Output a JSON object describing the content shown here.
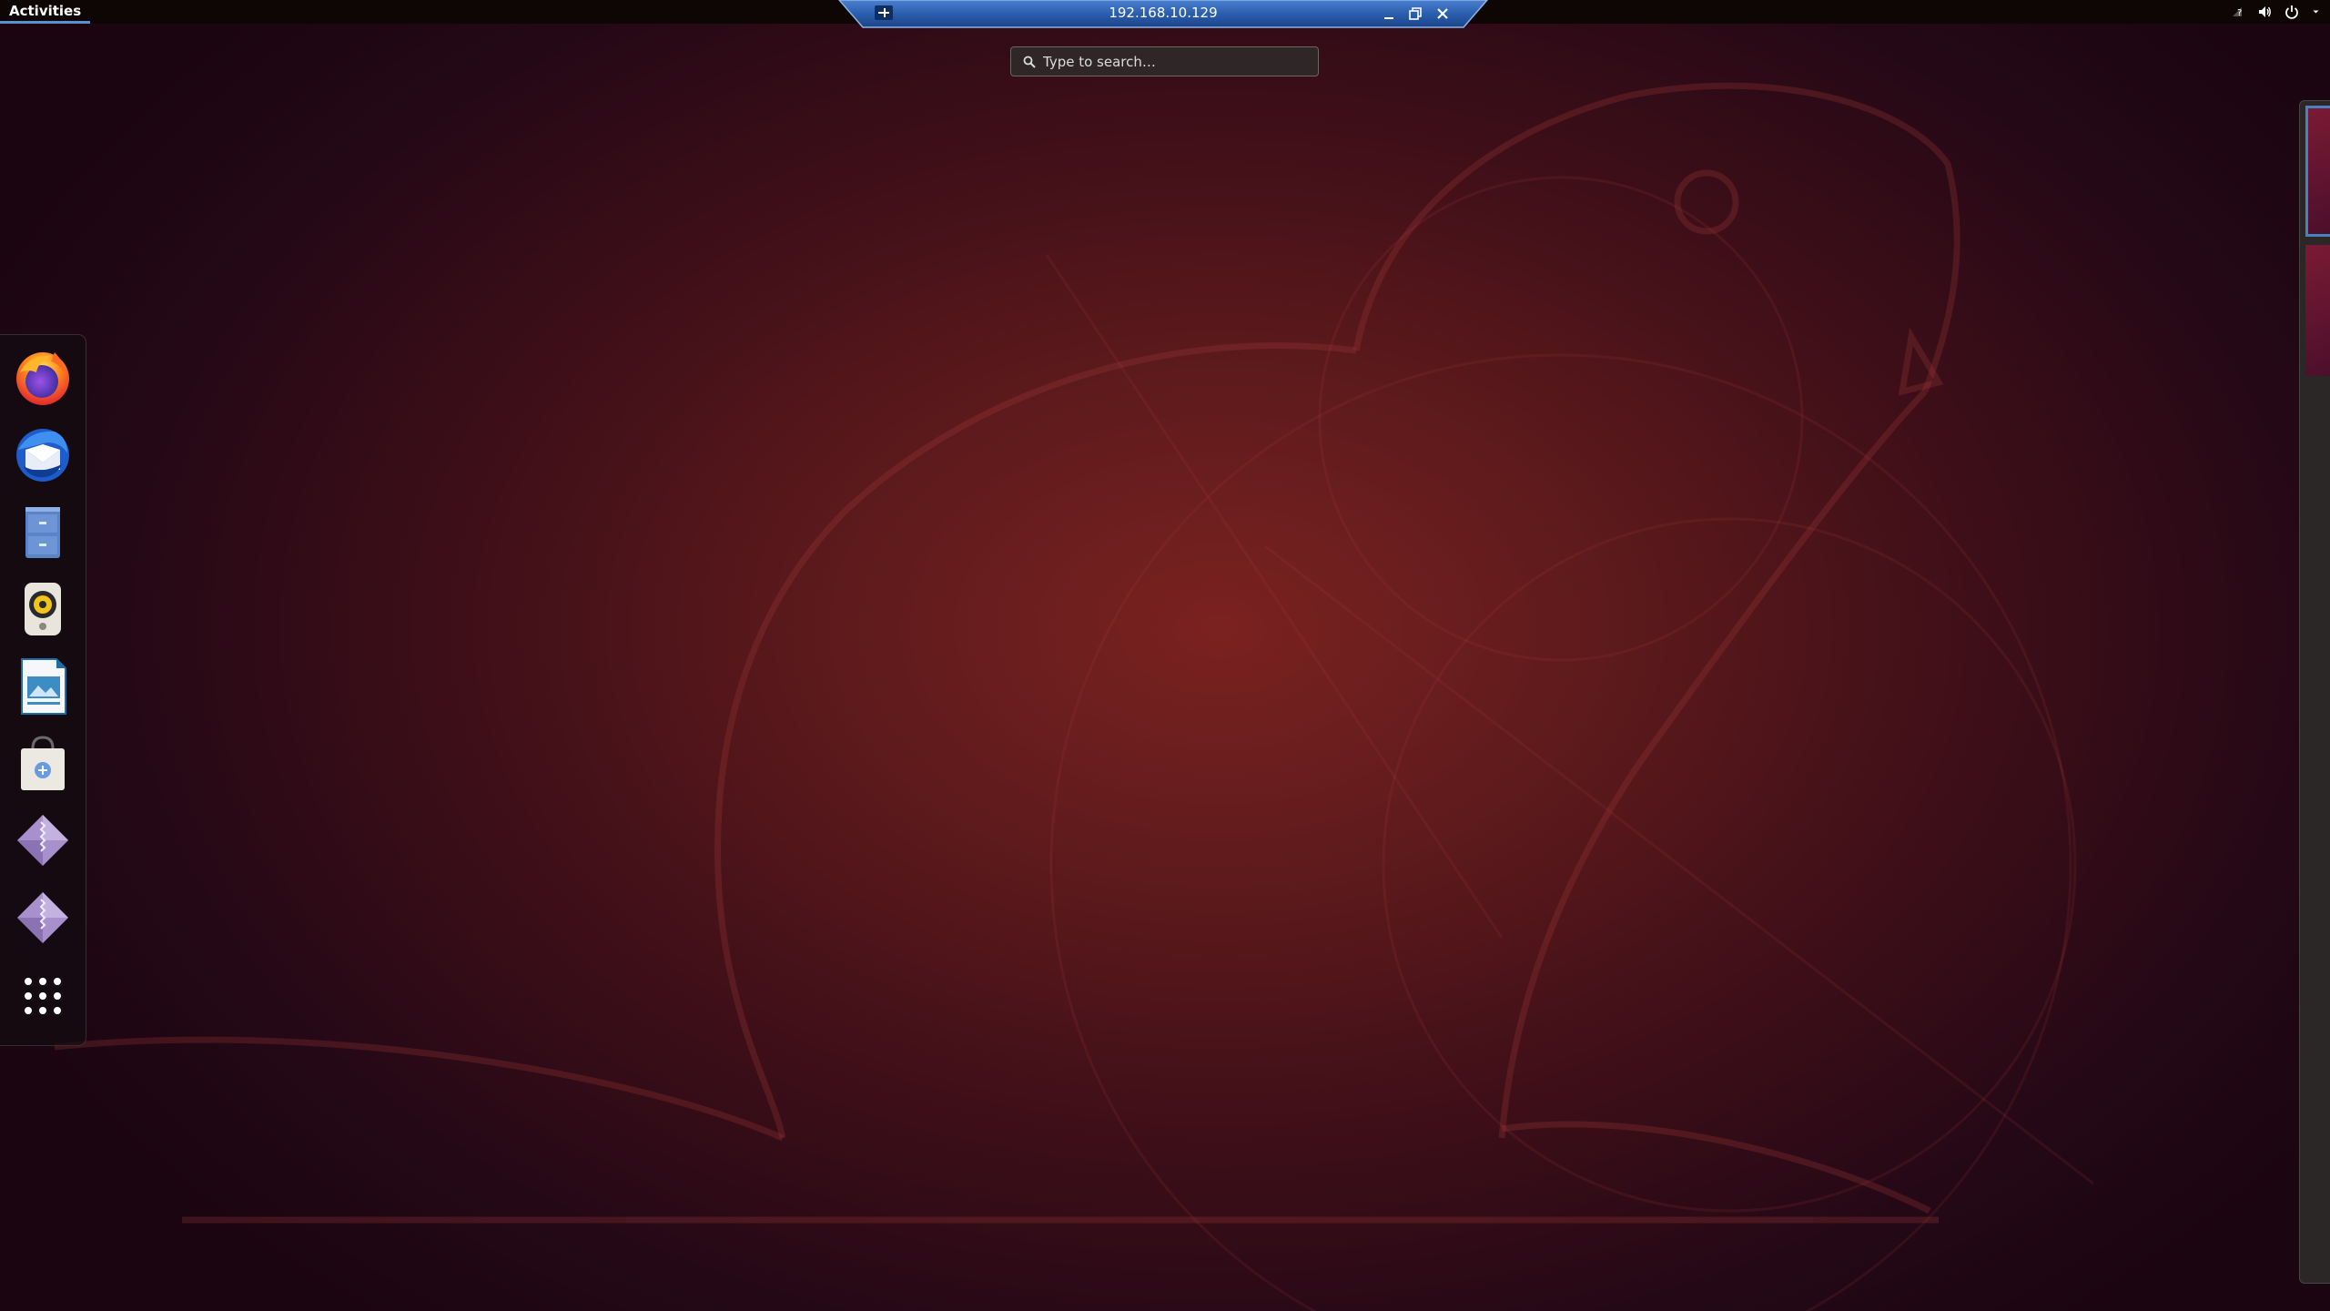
{
  "top_bar": {
    "activities_label": "Activities",
    "tray_icons": [
      "network-icon",
      "volume-icon",
      "power-icon",
      "menu-arrow-icon"
    ]
  },
  "remote_bar": {
    "title": "192.168.10.129",
    "buttons": [
      "pin-icon",
      "minimize-icon",
      "restore-icon",
      "close-icon"
    ]
  },
  "search": {
    "placeholder": "Type to search…"
  },
  "dock": {
    "items": [
      {
        "name": "firefox",
        "icon": "firefox-icon"
      },
      {
        "name": "thunderbird",
        "icon": "thunderbird-icon"
      },
      {
        "name": "files",
        "icon": "file-cabinet-icon"
      },
      {
        "name": "rhythmbox",
        "icon": "speaker-icon"
      },
      {
        "name": "libreoffice-impress",
        "icon": "presentation-icon"
      },
      {
        "name": "software",
        "icon": "shopping-bag-icon"
      },
      {
        "name": "archive-1",
        "icon": "archive-diamond-icon"
      },
      {
        "name": "archive-2",
        "icon": "archive-diamond-icon"
      },
      {
        "name": "show-applications",
        "icon": "app-grid-icon"
      }
    ]
  },
  "workspaces": {
    "count": 2,
    "active": 1
  },
  "colors": {
    "top_bar": "#0d0605",
    "accent": "#5b8fd0",
    "rdp_bar": "#2f64b4",
    "wallpaper_center": "#7a2220",
    "wallpaper_edge": "#1a0510"
  }
}
